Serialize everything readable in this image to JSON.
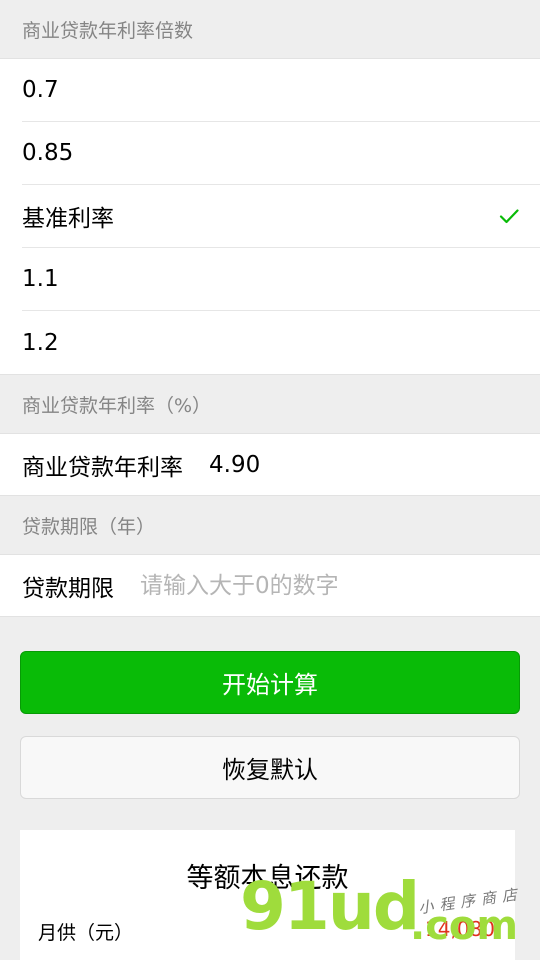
{
  "multiplier_section": {
    "title": "商业贷款年利率倍数",
    "options": [
      {
        "label": "0.7",
        "selected": false
      },
      {
        "label": "0.85",
        "selected": false
      },
      {
        "label": "基准利率",
        "selected": true
      },
      {
        "label": "1.1",
        "selected": false
      },
      {
        "label": "1.2",
        "selected": false
      }
    ]
  },
  "rate_section": {
    "title": "商业贷款年利率（%）",
    "label": "商业贷款年利率",
    "value": "4.90"
  },
  "term_section": {
    "title": "贷款期限（年）",
    "label": "贷款期限",
    "value": "",
    "placeholder": "请输入大于0的数字"
  },
  "buttons": {
    "calculate": "开始计算",
    "reset": "恢复默认"
  },
  "result": {
    "title": "等额本息还款",
    "monthly_label": "月供（元）",
    "monthly_value": "14,080"
  },
  "watermark": {
    "brand": "91ud",
    "domain": ".com",
    "tagline": "小程序商店"
  },
  "colors": {
    "accent": "#09bb07",
    "check": "#09bb07",
    "result_value": "#e0301e"
  }
}
